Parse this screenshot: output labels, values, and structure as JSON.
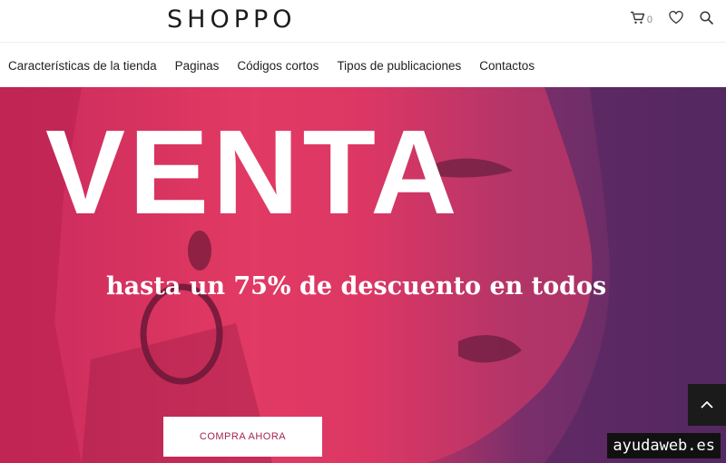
{
  "header": {
    "logo_text": "SHOPPO",
    "cart_count": "0"
  },
  "nav": {
    "items": [
      {
        "label": "Características de la tienda"
      },
      {
        "label": "Paginas"
      },
      {
        "label": "Códigos cortos"
      },
      {
        "label": "Tipos de publicaciones"
      },
      {
        "label": "Contactos"
      }
    ]
  },
  "hero": {
    "title": "VENTA",
    "subtitle": "hasta un 75% de descuento en todos",
    "cta_label": "COMPRA AHORA"
  },
  "watermark": {
    "text": "ayudaweb.es"
  },
  "icons": {
    "cart": "cart-icon",
    "wishlist": "heart-icon",
    "search": "search-icon",
    "scroll_top": "chevron-up-icon"
  }
}
